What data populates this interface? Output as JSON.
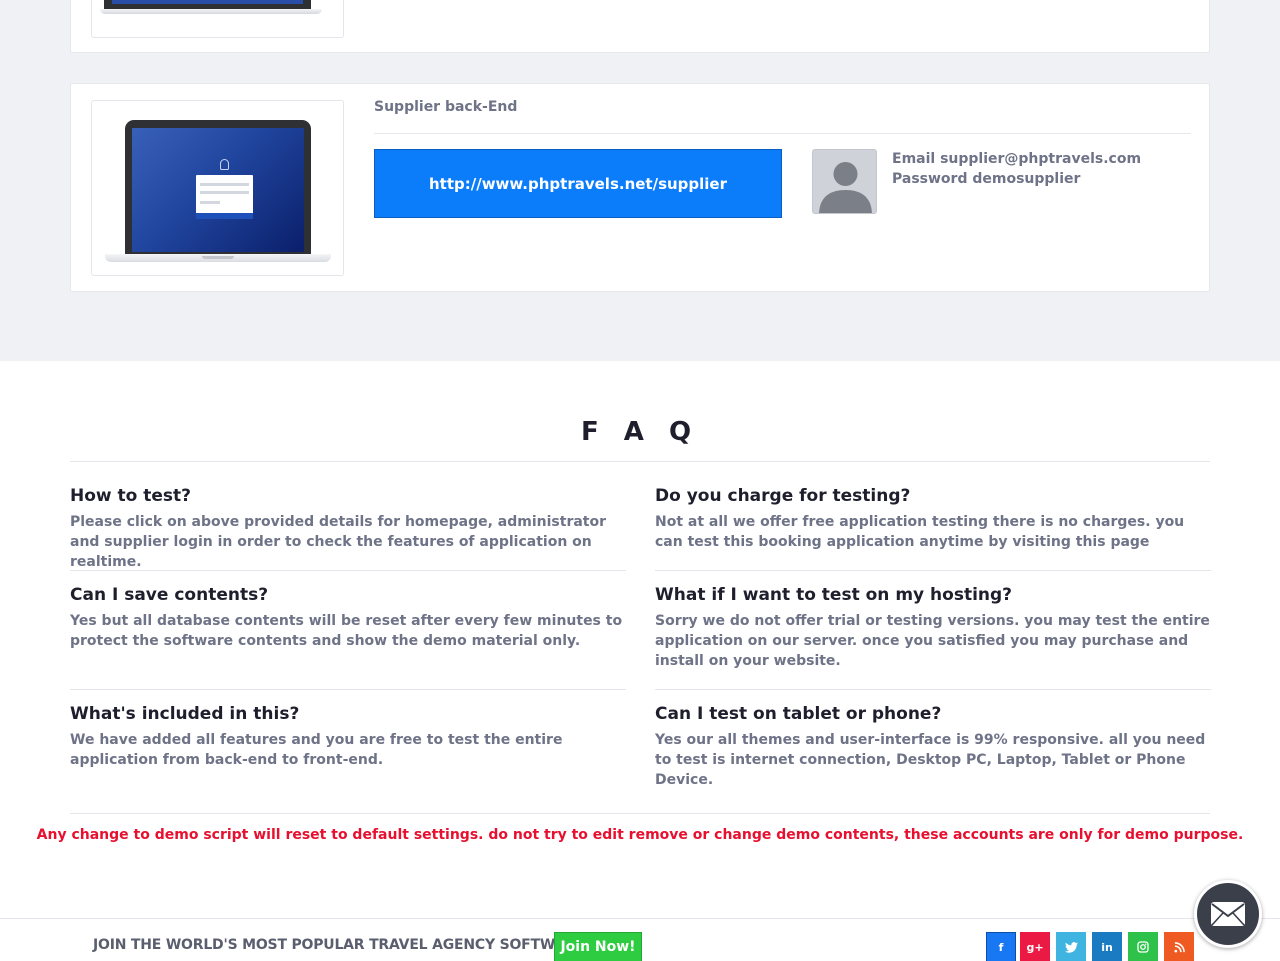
{
  "supplier_card": {
    "label": "Supplier back-End",
    "url_button": "http://www.phptravels.net/supplier",
    "email_line": "Email supplier@phptravels.com",
    "password_line": "Password demosupplier"
  },
  "faq": {
    "title": "F A Q",
    "items": [
      {
        "question": "How to test?",
        "answer": "Please click on above provided details for homepage, administrator and supplier login in order to check the features of application on realtime."
      },
      {
        "question": "Do you charge for testing?",
        "answer": "Not at all we offer free application testing there is no charges. you can test this booking application anytime by visiting this page"
      },
      {
        "question": "Can I save contents?",
        "answer": "Yes but all database contents will be reset after every few minutes to protect the software contents and show the demo material only."
      },
      {
        "question": "What if I want to test on my hosting?",
        "answer": "Sorry we do not offer trial or testing versions. you may test the entire application on our server. once you satisfied you may purchase and install on your website."
      },
      {
        "question": "What's included in this?",
        "answer": "We have added all features and you are free to test the entire application from back-end to front-end."
      },
      {
        "question": "Can I test on tablet or phone?",
        "answer": "Yes our all themes and user-interface is 99% responsive. all you need to test is internet connection, Desktop PC, Laptop, Tablet or Phone Device."
      }
    ]
  },
  "warning": "Any change to demo script will reset to default settings. do not try to edit remove or change demo contents, these accounts are only for demo purpose.",
  "footer": {
    "join_text": "JOIN THE WORLD'S MOST POPULAR TRAVEL AGENCY SOFTWARE",
    "join_button": "Join Now!",
    "social": [
      {
        "name": "facebook-icon",
        "glyph": "f",
        "color": "#1877f2"
      },
      {
        "name": "google-plus-icon",
        "glyph": "g+",
        "color": "#ea1a44"
      },
      {
        "name": "twitter-icon",
        "glyph": "t",
        "color": "#3fb4e1"
      },
      {
        "name": "linkedin-icon",
        "glyph": "in",
        "color": "#1a7bc2"
      },
      {
        "name": "instagram-icon",
        "glyph": "◎",
        "color": "#2ec24a"
      },
      {
        "name": "rss-icon",
        "glyph": "◉",
        "color": "#ef5a23"
      }
    ]
  },
  "colors": {
    "primary_button": "#0b7dfa",
    "join_button": "#2ecc40",
    "warning_text": "#e8102f"
  }
}
